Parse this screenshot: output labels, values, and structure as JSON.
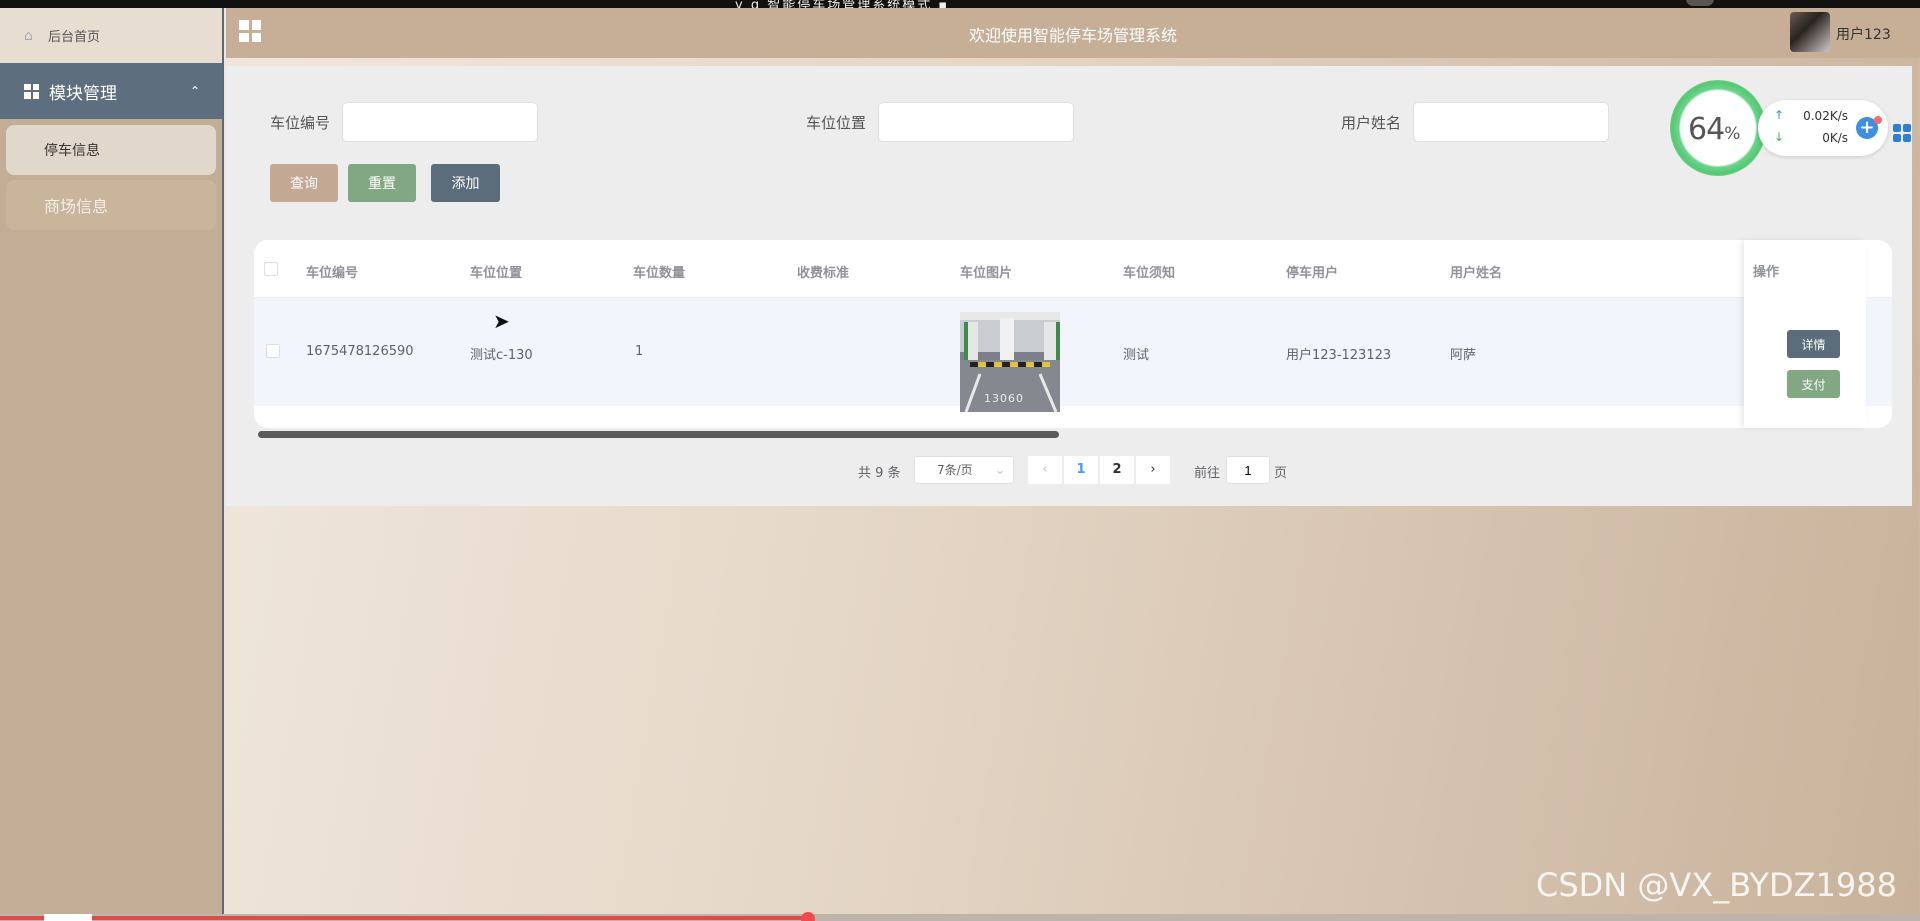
{
  "topbar": {
    "glyphs": "y  g  智能停车场管理系统模式 ▪"
  },
  "sidebar": {
    "home_label": "后台首页",
    "module_label": "模块管理",
    "items": [
      {
        "label": "停车信息"
      },
      {
        "label": "商场信息"
      }
    ]
  },
  "header": {
    "title": "欢迎使用智能停车场管理系统",
    "username": "用户123"
  },
  "search": {
    "fields": [
      {
        "label": "车位编号",
        "value": ""
      },
      {
        "label": "车位位置",
        "value": ""
      },
      {
        "label": "用户姓名",
        "value": ""
      }
    ],
    "buttons": {
      "query": "查询",
      "reset": "重置",
      "add": "添加"
    }
  },
  "table": {
    "columns": [
      "车位编号",
      "车位位置",
      "车位数量",
      "收费标准",
      "车位图片",
      "车位须知",
      "停车用户",
      "用户姓名",
      "操作"
    ],
    "rows": [
      {
        "code": "1675478126590",
        "location": "测试c-130",
        "count": "1",
        "fee": "",
        "notice": "测试",
        "user": "用户123-123123",
        "name": "阿萨",
        "detail_label": "详情",
        "pay_label": "支付"
      }
    ],
    "image_text": "13060"
  },
  "pagination": {
    "total": "共 9 条",
    "page_size": "7条/页",
    "pages": [
      "1",
      "2"
    ],
    "current": "1",
    "goto_label": "前往",
    "goto_value": "1",
    "page_word": "页"
  },
  "speed_widget": {
    "percent": "64",
    "percent_sign": "%",
    "upload": "0.02K/s",
    "download": "0K/s"
  },
  "watermark": "CSDN @VX_BYDZ1988",
  "colors": {
    "sidebar": "#c2ad96",
    "module_header": "#5d6e7e",
    "query_btn": "#c3a893",
    "reset_btn": "#82a883",
    "add_btn": "#5b6c7a",
    "page_active": "#409eff"
  }
}
